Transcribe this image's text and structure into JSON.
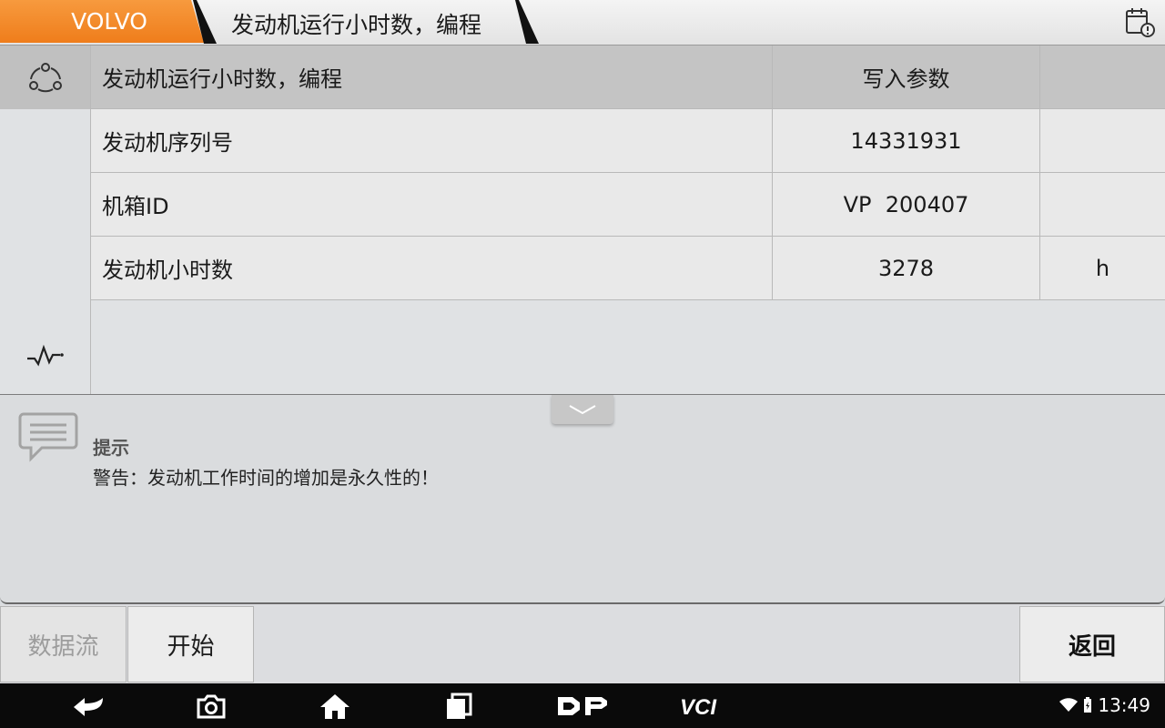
{
  "header": {
    "brand": "VOLVO",
    "page_title": "发动机运行小时数，编程"
  },
  "table": {
    "columns": [
      "发动机运行小时数，编程",
      "写入参数",
      ""
    ],
    "rows": [
      {
        "name": "发动机序列号",
        "value": "14331931",
        "unit": ""
      },
      {
        "name": "机箱ID",
        "value": "VP  200407",
        "unit": ""
      },
      {
        "name": "发动机小时数",
        "value": "3278",
        "unit": "h"
      }
    ]
  },
  "message": {
    "title": "提示",
    "text": "警告：发动机工作时间的增加是永久性的！"
  },
  "toolbar": {
    "data_stream_label": "数据流",
    "start_label": "开始",
    "back_label": "返回"
  },
  "status_bar": {
    "time": "13:49"
  },
  "colors": {
    "brand_accent": "#ef7d1b"
  }
}
